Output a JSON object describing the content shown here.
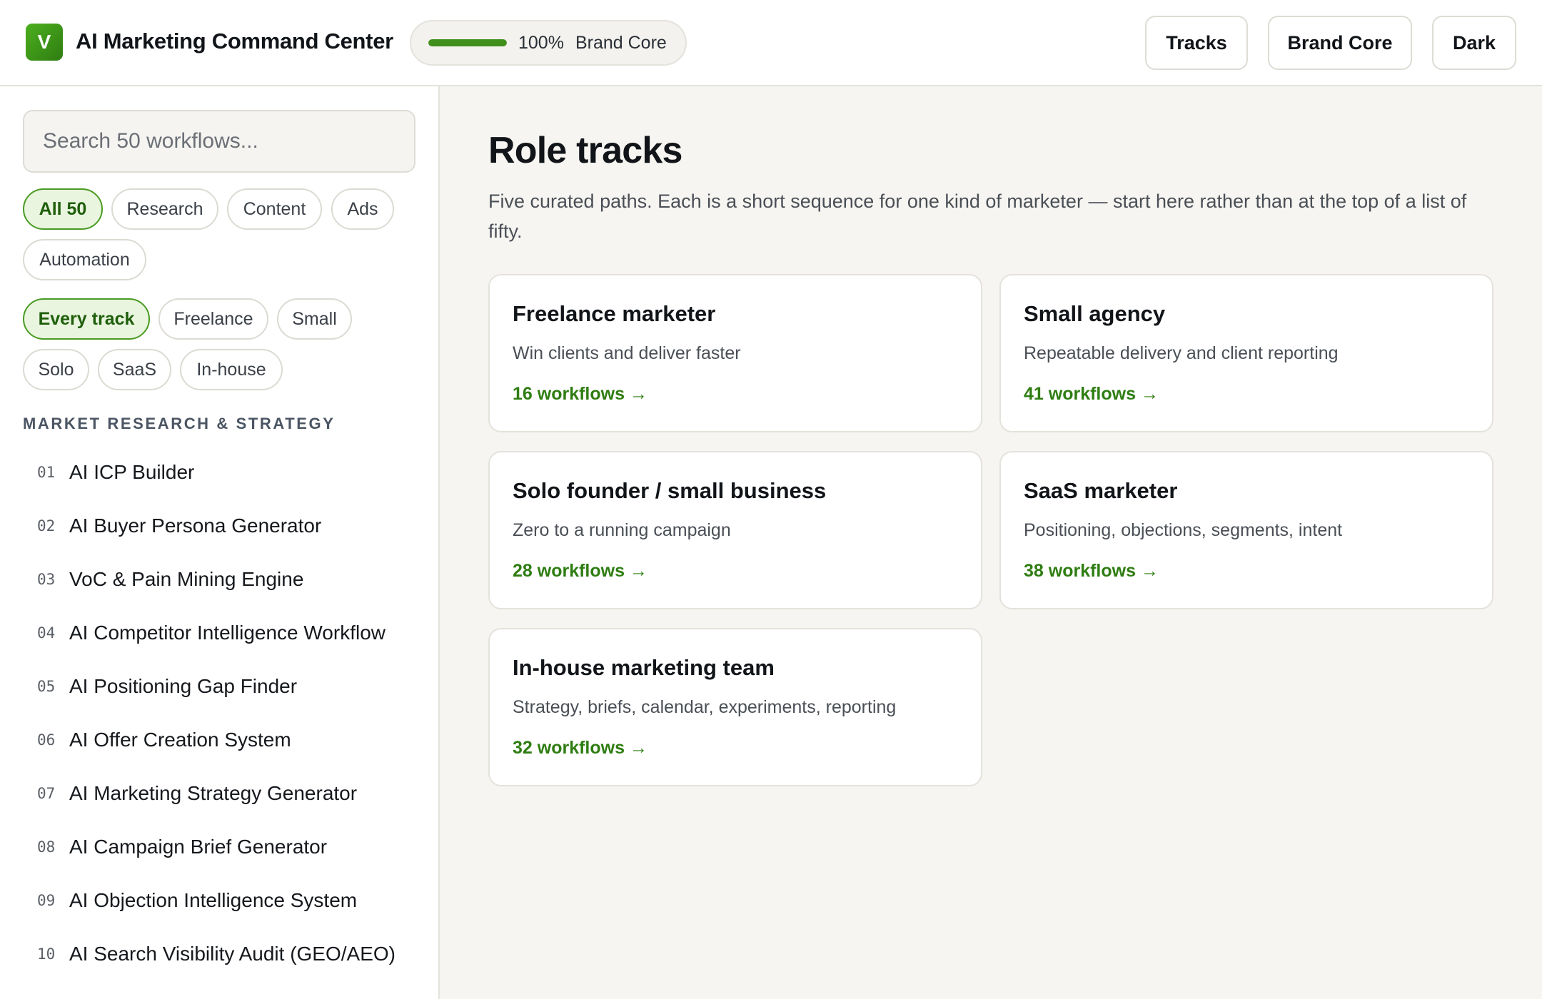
{
  "header": {
    "logo_letter": "V",
    "title": "AI Marketing Command Center",
    "brand_core": {
      "percent_label": "100%",
      "progress": 1.0,
      "label": "Brand Core"
    },
    "buttons": {
      "tracks": "Tracks",
      "brand_core": "Brand Core",
      "dark": "Dark"
    }
  },
  "sidebar": {
    "search_placeholder": "Search 50 workflows...",
    "category_chips": [
      "All 50",
      "Research",
      "Content",
      "Ads",
      "Automation"
    ],
    "track_chips": [
      "Every track",
      "Freelance",
      "Small",
      "Solo",
      "SaaS",
      "In-house"
    ],
    "section_label": "MARKET RESEARCH & STRATEGY",
    "workflows": [
      {
        "num": "01",
        "name": "AI ICP Builder"
      },
      {
        "num": "02",
        "name": "AI Buyer Persona Generator"
      },
      {
        "num": "03",
        "name": "VoC & Pain Mining Engine"
      },
      {
        "num": "04",
        "name": "AI Competitor Intelligence Workflow"
      },
      {
        "num": "05",
        "name": "AI Positioning Gap Finder"
      },
      {
        "num": "06",
        "name": "AI Offer Creation System"
      },
      {
        "num": "07",
        "name": "AI Marketing Strategy Generator"
      },
      {
        "num": "08",
        "name": "AI Campaign Brief Generator"
      },
      {
        "num": "09",
        "name": "AI Objection Intelligence System"
      },
      {
        "num": "10",
        "name": "AI Search Visibility Audit (GEO/AEO)"
      }
    ]
  },
  "main": {
    "title": "Role tracks",
    "description": "Five curated paths. Each is a short sequence for one kind of marketer — start here rather than at the top of a list of fifty.",
    "tracks": [
      {
        "title": "Freelance marketer",
        "subtitle": "Win clients and deliver faster",
        "link": "16 workflows →"
      },
      {
        "title": "Small agency",
        "subtitle": "Repeatable delivery and client reporting",
        "link": "41 workflows →"
      },
      {
        "title": "Solo founder / small business",
        "subtitle": "Zero to a running campaign",
        "link": "28 workflows →"
      },
      {
        "title": "SaaS marketer",
        "subtitle": "Positioning, objections, segments, intent",
        "link": "38 workflows →"
      },
      {
        "title": "In-house marketing team",
        "subtitle": "Strategy, briefs, calendar, experiments, reporting",
        "link": "32 workflows →"
      }
    ]
  },
  "colors": {
    "accent": "#3f8f1a",
    "accent_text": "#2f7d12",
    "chip_active_bg": "#e9f5df",
    "main_bg": "#f6f5f1"
  }
}
